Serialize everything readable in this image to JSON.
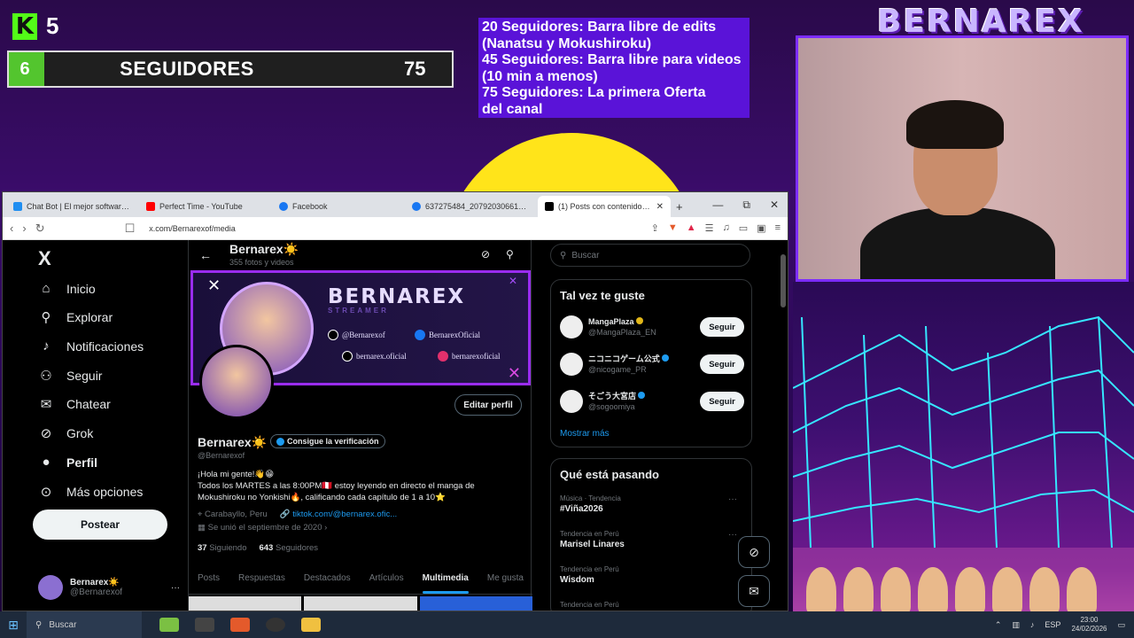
{
  "overlay": {
    "kick_logo": "K",
    "kick_viewers": "5",
    "goal": {
      "left": "6",
      "title": "SEGUIDORES",
      "right": "75",
      "progress_fraction": 0.08
    },
    "goals_lines": [
      "20 Seguidores: Barra libre de edits",
      "(Nanatsu y Mokushiroku)",
      "45 Seguidores: Barra libre para videos",
      "(10 min a menos)",
      "75 Seguidores: La primera Oferta",
      "del canal"
    ],
    "brand": "BERNAREX"
  },
  "browser": {
    "tabs": [
      {
        "label": "Chat Bot | El mejor software para ...",
        "icon_color": "#1f8ef1"
      },
      {
        "label": "Perfect Time - YouTube",
        "icon_color": "#ff0000"
      },
      {
        "label": "Facebook",
        "icon_color": "#1877f2"
      },
      {
        "label": "637275484_2079203066171278_8...",
        "icon_color": "#1877f2"
      },
      {
        "label": "(1) Posts con contenido multi...",
        "icon_color": "#000000",
        "active": true
      }
    ],
    "url": "x.com/Bernarexof/media",
    "window_controls": [
      "—",
      "⧉",
      "✕"
    ]
  },
  "xnav": {
    "logo": "X",
    "items": [
      {
        "label": "Inicio",
        "icon": "home-icon",
        "glyph": "⌂"
      },
      {
        "label": "Explorar",
        "icon": "search-icon",
        "glyph": "⚲"
      },
      {
        "label": "Notificaciones",
        "icon": "bell-icon",
        "glyph": "🔔"
      },
      {
        "label": "Seguir",
        "icon": "add-person-icon",
        "glyph": "👤"
      },
      {
        "label": "Chatear",
        "icon": "mail-icon",
        "glyph": "✉"
      },
      {
        "label": "Grok",
        "icon": "grok-icon",
        "glyph": "⊘"
      },
      {
        "label": "Perfil",
        "icon": "person-icon",
        "glyph": "👤",
        "bold": true
      },
      {
        "label": "Más opciones",
        "icon": "more-icon",
        "glyph": "⋯"
      }
    ],
    "post_button": "Postear",
    "account": {
      "name": "Bernarex☀️",
      "handle": "@Bernarexof",
      "more": "···"
    }
  },
  "profile": {
    "header_name": "Bernarex☀️",
    "header_sub": "355 fotos y videos",
    "banner": {
      "title": "BERNAREX",
      "subtitle": "STREAMER",
      "socials": [
        {
          "label": "@Bernarexof",
          "color": "#000000"
        },
        {
          "label": "BernarexOficial",
          "color": "#1877f2"
        },
        {
          "label": "bernarex.oficial",
          "color": "#000000"
        },
        {
          "label": "bernarexoficial",
          "color": "#e1306c"
        }
      ]
    },
    "edit_button": "Editar perfil",
    "name": "Bernarex☀️",
    "verify_button": "Consigue la verificación",
    "handle": "@Bernarexof",
    "bio_line1": "¡Hola mi gente!👋😁",
    "bio_line2": "Todos los MARTES a las 8:00PM🇵🇪 estoy leyendo en directo el manga de Mokushiroku no Yonkishi🔥, calificando cada capítulo de 1 a 10⭐",
    "location": "Carabayllo, Peru",
    "link": "tiktok.com/@bernarex.ofic...",
    "joined": "Se unió el septiembre de 2020 ›",
    "following_count": "37",
    "following_label": "Siguiendo",
    "followers_count": "643",
    "followers_label": "Seguidores",
    "tabs": [
      "Posts",
      "Respuestas",
      "Destacados",
      "Artículos",
      "Multimedia",
      "Me gusta"
    ],
    "active_tab": "Multimedia"
  },
  "right": {
    "search_placeholder": "Buscar",
    "suggest_title": "Tal vez te guste",
    "suggestions": [
      {
        "name": "MangaPlaza",
        "handle": "@MangaPlaza_EN",
        "badge": "gold",
        "button": "Seguir"
      },
      {
        "name": "ニコニコゲーム公式",
        "handle": "@nicogame_PR",
        "badge": "blue",
        "button": "Seguir"
      },
      {
        "name": "そごう大宮店",
        "handle": "@sogoomiya",
        "badge": "blue",
        "button": "Seguir"
      }
    ],
    "show_more": "Mostrar más",
    "trends_title": "Qué está pasando",
    "trends": [
      {
        "context": "Música · Tendencia",
        "topic": "#Viña2026"
      },
      {
        "context": "Tendencia en Perú",
        "topic": "Marisel Linares"
      },
      {
        "context": "Tendencia en Perú",
        "topic": "Wisdom"
      },
      {
        "context": "Tendencia en Perú",
        "topic": ""
      }
    ]
  },
  "taskbar": {
    "search": "Buscar",
    "lang": "ESP",
    "time": "23:00",
    "date": "24/02/2026"
  },
  "colors": {
    "x_blue": "#1d9bf0",
    "kick_green": "#53fc18",
    "overlay_purple": "#5a13d8",
    "sun_yellow": "#ffe41a"
  }
}
